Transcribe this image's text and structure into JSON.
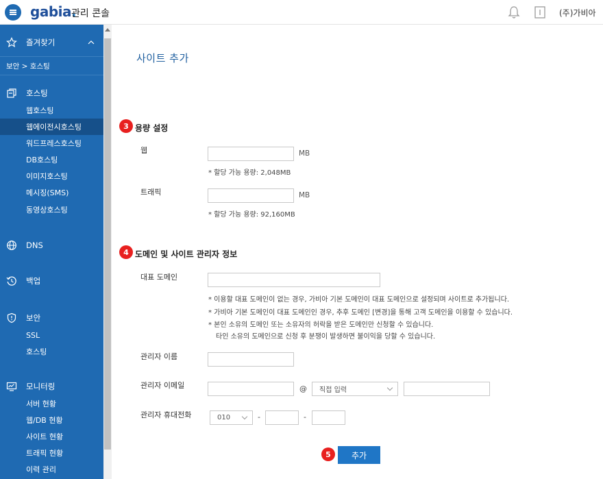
{
  "header": {
    "logo": "gabia",
    "console_title": "관리 콘솔",
    "company": "(주)가비아"
  },
  "sidebar": {
    "favorites_label": "즐겨찾기",
    "breadcrumb": "보안 > 호스팅",
    "hosting": {
      "label": "호스팅",
      "items": [
        "웹호스팅",
        "웹에이전시호스팅",
        "워드프레스호스팅",
        "DB호스팅",
        "이미지호스팅",
        "메시징(SMS)",
        "동영상호스팅"
      ]
    },
    "dns_label": "DNS",
    "backup_label": "백업",
    "security": {
      "label": "보안",
      "items": [
        "SSL",
        "호스팅"
      ]
    },
    "monitoring": {
      "label": "모니터링",
      "items": [
        "서버 현황",
        "웹/DB 현황",
        "사이트 현황",
        "트래픽 현황",
        "이력 관리"
      ]
    }
  },
  "main": {
    "page_title": "사이트 추가",
    "capacity": {
      "step": "3",
      "title": "용량 설정",
      "web_label": "웹",
      "web_value": "",
      "web_unit": "MB",
      "web_note": "* 할당 가능 용량: 2,048MB",
      "traffic_label": "트래픽",
      "traffic_value": "",
      "traffic_unit": "MB",
      "traffic_note": "* 할당 가능 용량: 92,160MB"
    },
    "domain": {
      "step": "4",
      "title": "도메인 및 사이트 관리자 정보",
      "rep_domain_label": "대표 도메인",
      "rep_domain_value": "",
      "notes": [
        "*  이용할 대표 도메인이 없는 경우, 가비아 기본 도메인이 대표 도메인으로 설정되며 사이트로 추가됩니다.",
        "*  가비아 기본 도메인이 대표 도메인인 경우, 추후 도메인 [변경]을 통해 고객 도메인을 이용할 수 있습니다.",
        "*  본인 소유의 도메인 또는 소유자의 허락을 받은 도메인만 신청할 수 있습니다.",
        "타인 소유의 도메인으로 신청 후 분쟁이 발생하면 불이익을 당할 수 있습니다."
      ],
      "admin_name_label": "관리자 이름",
      "admin_email_label": "관리자 이메일",
      "email_at": "@",
      "email_domain_select": "직접 입력",
      "admin_phone_label": "관리자 휴대전화",
      "phone_prefix_select": "010",
      "phone_dash": "-"
    },
    "submit": {
      "step": "5",
      "label": "추가"
    }
  }
}
